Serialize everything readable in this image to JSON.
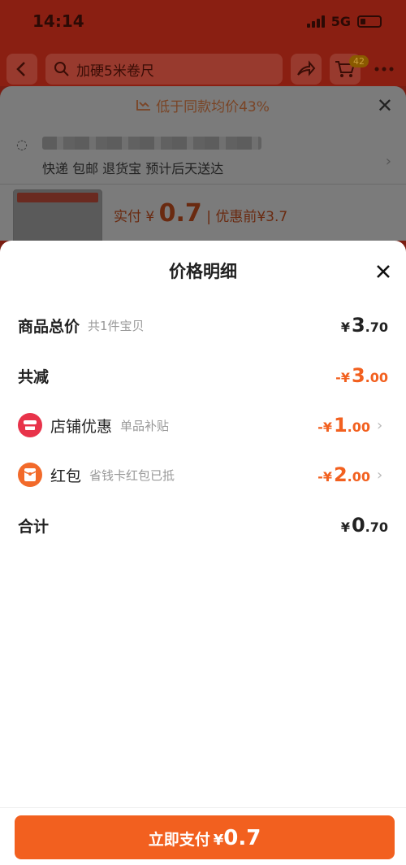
{
  "status": {
    "time": "14:14",
    "network": "5G"
  },
  "nav": {
    "search_text": "加硬5米卷尺",
    "cart_count": "42"
  },
  "background": {
    "banner_text": "低于同款均价43%",
    "address_subtitle": "快递 包邮 退货宝 预计后天送达",
    "paid_label": "实付",
    "paid_currency": "¥",
    "paid_value": "0.7",
    "before_label": "优惠前¥3.7"
  },
  "modal": {
    "title": "价格明细",
    "rows": [
      {
        "label": "商品总价",
        "sub": "共1件宝贝",
        "currency": "¥",
        "int": "3",
        "dec": ".70"
      },
      {
        "label": "共减",
        "sub": "",
        "currency": "-¥",
        "int": "3",
        "dec": ".00"
      },
      {
        "label": "店铺优惠",
        "sub": "单品补贴",
        "currency": "-¥",
        "int": "1",
        "dec": ".00"
      },
      {
        "label": "红包",
        "sub": "省钱卡红包已抵",
        "currency": "-¥",
        "int": "2",
        "dec": ".00"
      },
      {
        "label": "合计",
        "sub": "",
        "currency": "¥",
        "int": "0",
        "dec": ".70"
      }
    ]
  },
  "pay_button": {
    "text": "立即支付",
    "currency": "¥",
    "value": "0.7"
  },
  "colors": {
    "accent": "#f2601f",
    "store_icon": "#e8334a",
    "redpacket_icon": "#f26a2a"
  }
}
